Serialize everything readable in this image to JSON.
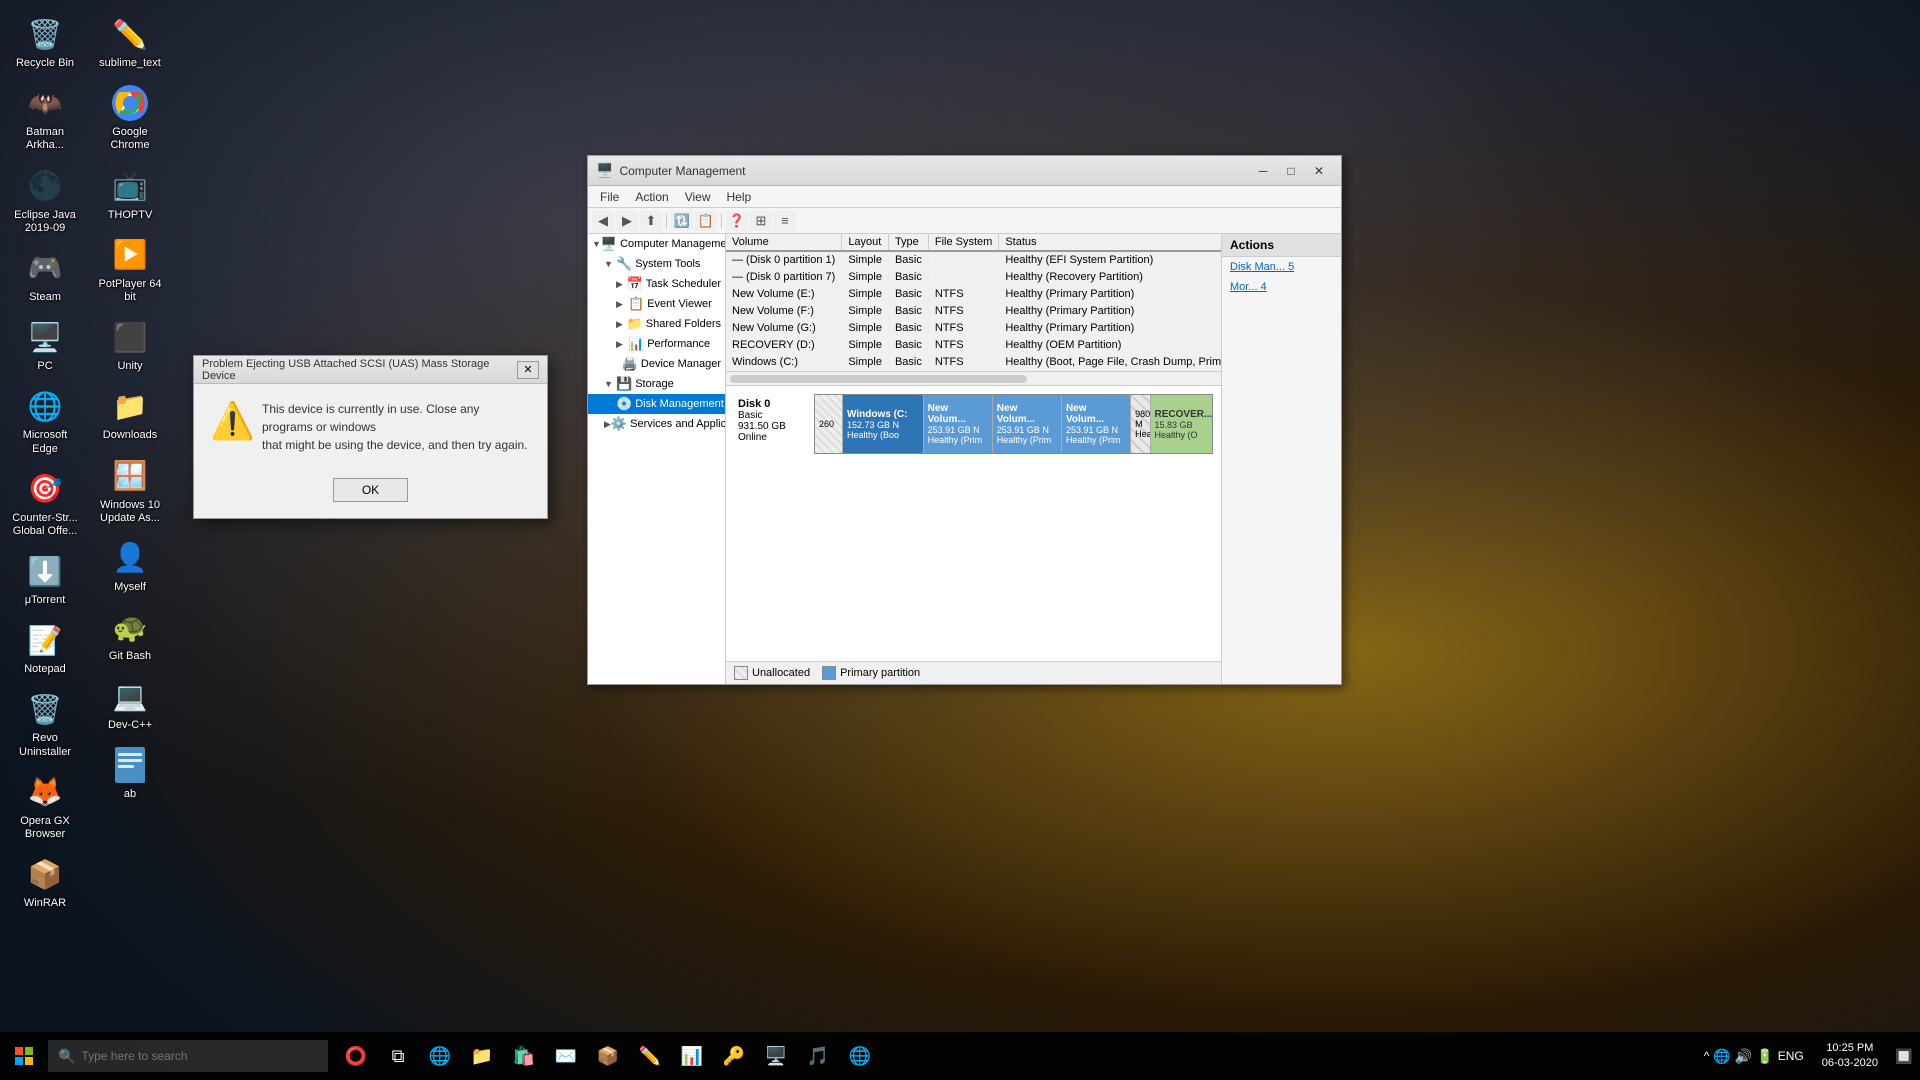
{
  "desktop": {
    "icons": [
      {
        "id": "recycle-bin",
        "label": "Recycle Bin",
        "icon": "🗑️",
        "row": 0
      },
      {
        "id": "dev-cpp",
        "label": "Dev-C++",
        "icon": "💻",
        "row": 1
      },
      {
        "id": "ab",
        "label": "ab",
        "icon": "📄",
        "row": 2
      },
      {
        "id": "batman",
        "label": "Batman Arkha...",
        "icon": "🦇",
        "row": 3
      },
      {
        "id": "eclipse",
        "label": "Eclipse Java 2019-09",
        "icon": "🌑",
        "row": 4
      },
      {
        "id": "steam",
        "label": "Steam",
        "icon": "🎮",
        "row": 5
      },
      {
        "id": "pc",
        "label": "PC",
        "icon": "🖥️",
        "row": 6
      },
      {
        "id": "msedge",
        "label": "Microsoft Edge",
        "icon": "🌐",
        "row": 7
      },
      {
        "id": "csglobal",
        "label": "Counter-Str... Global Offe...",
        "icon": "🎯",
        "row": 8
      },
      {
        "id": "utorrent",
        "label": "μTorrent",
        "icon": "⬇️",
        "row": 9
      },
      {
        "id": "notepad",
        "label": "Notepad",
        "icon": "📝",
        "row": 10
      },
      {
        "id": "revo",
        "label": "Revo Uninstaller",
        "icon": "🗑️",
        "row": 11
      },
      {
        "id": "opera",
        "label": "Opera GX Browser",
        "icon": "🦊",
        "row": 12
      },
      {
        "id": "winrar",
        "label": "WinRAR",
        "icon": "📦",
        "row": 13
      },
      {
        "id": "sublime",
        "label": "sublime_text",
        "icon": "✏️",
        "row": 14
      },
      {
        "id": "google-chrome",
        "label": "Google Chrome",
        "icon": "🌐",
        "row": 15
      },
      {
        "id": "thoptv",
        "label": "THOPTV",
        "icon": "📺",
        "row": 16
      },
      {
        "id": "potplayer",
        "label": "PotPlayer 64 bit",
        "icon": "▶️",
        "row": 17
      },
      {
        "id": "unity",
        "label": "Unity",
        "icon": "⬛",
        "row": 18
      },
      {
        "id": "downloads",
        "label": "Downloads",
        "icon": "📁",
        "row": 19
      },
      {
        "id": "win10update",
        "label": "Windows 10 Update As...",
        "icon": "🪟",
        "row": 20
      },
      {
        "id": "myself",
        "label": "Myself",
        "icon": "👤",
        "row": 21
      },
      {
        "id": "gitbash",
        "label": "Git Bash",
        "icon": "🐢",
        "row": 22
      }
    ]
  },
  "taskbar": {
    "search_placeholder": "Type here to search",
    "clock": {
      "time": "10:25 PM",
      "date": "06-03-2020"
    },
    "language": "ENG"
  },
  "cm_window": {
    "title": "Computer Management",
    "menu": [
      "File",
      "Action",
      "View",
      "Help"
    ],
    "tree": {
      "items": [
        {
          "label": "Computer Management (L",
          "level": 0,
          "expanded": true
        },
        {
          "label": "System Tools",
          "level": 1,
          "expanded": true
        },
        {
          "label": "Task Scheduler",
          "level": 2
        },
        {
          "label": "Event Viewer",
          "level": 2
        },
        {
          "label": "Shared Folders",
          "level": 2
        },
        {
          "label": "Performance",
          "level": 2
        },
        {
          "label": "Device Manager",
          "level": 2
        },
        {
          "label": "Storage",
          "level": 1,
          "expanded": true
        },
        {
          "label": "Disk Management",
          "level": 2,
          "selected": true
        },
        {
          "label": "Services and Applicatio...",
          "level": 1
        }
      ]
    },
    "columns": [
      "Volume",
      "Layout",
      "Type",
      "File System",
      "Status"
    ],
    "rows": [
      {
        "volume": "— (Disk 0 partition 1)",
        "layout": "Simple",
        "type": "Basic",
        "fs": "",
        "status": "Healthy (EFI System Partition)"
      },
      {
        "volume": "— (Disk 0 partition 7)",
        "layout": "Simple",
        "type": "Basic",
        "fs": "",
        "status": "Healthy (Recovery Partition)"
      },
      {
        "volume": "New Volume (E:)",
        "layout": "Simple",
        "type": "Basic",
        "fs": "NTFS",
        "status": "Healthy (Primary Partition)"
      },
      {
        "volume": "New Volume (F:)",
        "layout": "Simple",
        "type": "Basic",
        "fs": "NTFS",
        "status": "Healthy (Primary Partition)"
      },
      {
        "volume": "New Volume (G:)",
        "layout": "Simple",
        "type": "Basic",
        "fs": "NTFS",
        "status": "Healthy (Primary Partition)"
      },
      {
        "volume": "RECOVERY (D:)",
        "layout": "Simple",
        "type": "Basic",
        "fs": "NTFS",
        "status": "Healthy (OEM Partition)"
      },
      {
        "volume": "Windows (C:)",
        "layout": "Simple",
        "type": "Basic",
        "fs": "NTFS",
        "status": "Healthy (Boot, Page File, Crash Dump, Primary Partition)"
      }
    ],
    "disk": {
      "name": "Disk 0",
      "type": "Basic",
      "size": "931.50 GB",
      "status": "Online",
      "partitions": [
        {
          "label": "",
          "size": "260",
          "type": "unalloc",
          "width": 4
        },
        {
          "label": "Windows (C:)",
          "size": "152.73 GB N",
          "status": "Healthy (Boo",
          "type": "primary",
          "width": 18
        },
        {
          "label": "New Volum...",
          "size": "253.91 GB N",
          "status": "Healthy (Prim",
          "type": "primary",
          "width": 16
        },
        {
          "label": "New Volum...",
          "size": "253.91 GB N",
          "status": "Healthy (Prim",
          "type": "primary",
          "width": 16
        },
        {
          "label": "New Volum...",
          "size": "253.91 GB N",
          "status": "Healthy (Prim",
          "type": "primary",
          "width": 16
        },
        {
          "label": "",
          "size": "980 M",
          "status": "Healt...",
          "type": "hatched",
          "width": 4
        },
        {
          "label": "RECOVER...",
          "size": "15.83 GB",
          "status": "Healthy (O",
          "type": "recover",
          "width": 10
        }
      ]
    },
    "legend": [
      {
        "label": "Unallocated",
        "color": "#e8e8e8",
        "pattern": "hatched"
      },
      {
        "label": "Primary partition",
        "color": "#5b9bd5"
      }
    ],
    "actions": {
      "header": "Actions",
      "items": [
        "Disk Man...",
        "Mor..."
      ]
    }
  },
  "usb_dialog": {
    "title": "Problem Ejecting USB Attached SCSI (UAS) Mass Storage Device",
    "message": "This device is currently in use. Close any programs or windows\nthat might be using the device, and then try again.",
    "ok_button": "OK"
  }
}
